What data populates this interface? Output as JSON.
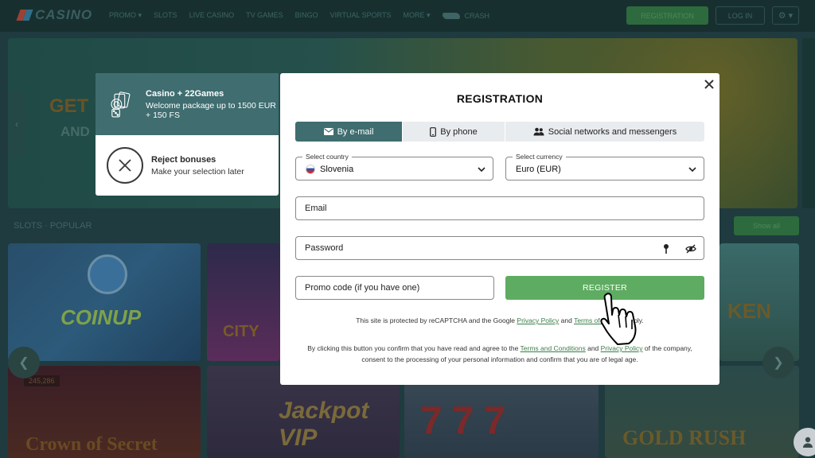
{
  "site": {
    "logo_text": "CASINO",
    "nav": [
      "PROMO",
      "SLOTS",
      "LIVE CASINO",
      "TV GAMES",
      "BINGO",
      "VIRTUAL SPORTS",
      "MORE",
      "Crash"
    ],
    "register_label": "REGISTRATION",
    "login_label": "LOG IN",
    "hero_line1": "GET",
    "hero_line2": "AND",
    "section_title": "SLOTS · POPULAR",
    "show_all": "Show all",
    "tiles": [
      "COINUP",
      "CITY",
      "KEN",
      "Crown of Secret",
      "Jackpot VIP",
      "777",
      "GOLD RUSH"
    ],
    "tile_badge": "245,286"
  },
  "bonus": {
    "option1_title": "Casino + 22Games",
    "option1_desc": "Welcome package up to 1500 EUR + 150 FS",
    "option2_title": "Reject bonuses",
    "option2_desc": "Make your selection later"
  },
  "modal": {
    "title": "REGISTRATION",
    "tabs": [
      "By e-mail",
      "By phone",
      "Social networks and messengers"
    ],
    "country_label": "Select country",
    "country_value": "Slovenia",
    "currency_label": "Select currency",
    "currency_value": "Euro (EUR)",
    "email_placeholder": "Email",
    "password_placeholder": "Password",
    "promo_placeholder": "Promo code (if you have one)",
    "register_button": "REGISTER",
    "recaptcha_prefix": "This site is protected by reCAPTCHA and the Google ",
    "privacy_policy": "Privacy Policy",
    "and": " and ",
    "terms_of_service": "Terms of Service",
    "recaptcha_suffix": " apply.",
    "legal_prefix": "By clicking this button you confirm that you have read and agree to the ",
    "terms_and_conditions": "Terms and Conditions",
    "legal_and": " and ",
    "legal_privacy": "Privacy Policy",
    "legal_suffix": " of the company, consent to the processing of your personal information and confirm that you are of legal age."
  },
  "colors": {
    "accent_teal": "#3f6d70",
    "register_green": "#5eac61",
    "link_green": "#3a7d4a"
  },
  "icons": [
    "cards-dice-icon",
    "reject-x-icon",
    "close-icon",
    "envelope-icon",
    "phone-icon",
    "users-icon",
    "chevron-down-icon",
    "key-icon",
    "eye-off-icon",
    "hand-cursor-icon",
    "support-icon"
  ]
}
